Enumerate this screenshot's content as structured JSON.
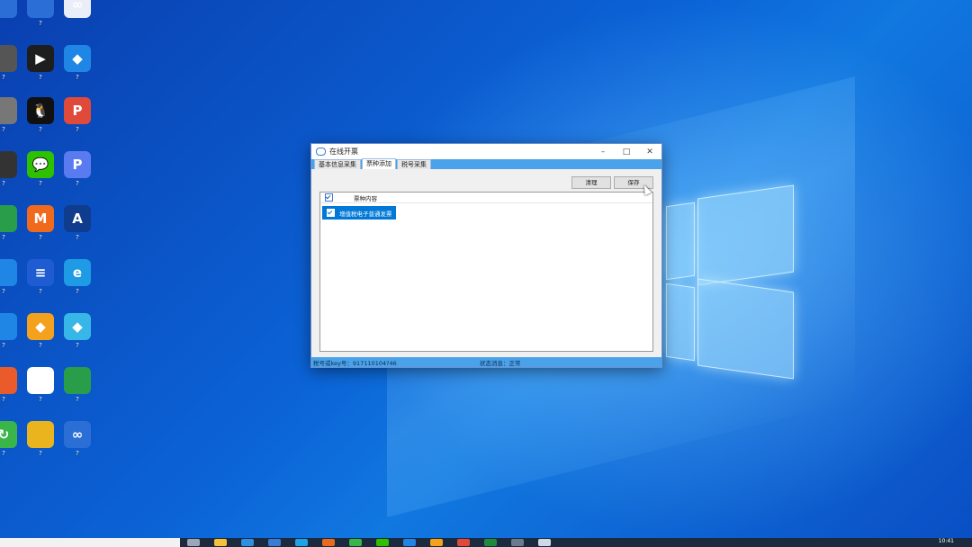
{
  "desktop": {
    "icons": [
      {
        "label": "",
        "glyph": "",
        "color": "#2b6fd6"
      },
      {
        "label": "?",
        "glyph": "",
        "color": "#2b6fd6"
      },
      {
        "label": "",
        "glyph": "∞",
        "color": "#e9eef9"
      },
      {
        "label": "?",
        "glyph": "",
        "color": "#555"
      },
      {
        "label": "?",
        "glyph": "▶",
        "color": "#1e1e1e"
      },
      {
        "label": "?",
        "glyph": "◆",
        "color": "#1f86e5"
      },
      {
        "label": "?",
        "glyph": "",
        "color": "#777"
      },
      {
        "label": "?",
        "glyph": "🐧",
        "color": "#111"
      },
      {
        "label": "?",
        "glyph": "P",
        "color": "#e04a3a"
      },
      {
        "label": "?",
        "glyph": "",
        "color": "#333"
      },
      {
        "label": "?",
        "glyph": "💬",
        "color": "#2dc100"
      },
      {
        "label": "?",
        "glyph": "P",
        "color": "#5a7bf0"
      },
      {
        "label": "?",
        "glyph": "",
        "color": "#2a9d4a"
      },
      {
        "label": "?",
        "glyph": "M",
        "color": "#f06a1e"
      },
      {
        "label": "?",
        "glyph": "A",
        "color": "#0f3c8c"
      },
      {
        "label": "?",
        "glyph": "",
        "color": "#1f86e5"
      },
      {
        "label": "?",
        "glyph": "≡",
        "color": "#1f5bd1"
      },
      {
        "label": "?",
        "glyph": "e",
        "color": "#1f9be5"
      },
      {
        "label": "?",
        "glyph": "",
        "color": "#1f86e5"
      },
      {
        "label": "?",
        "glyph": "◆",
        "color": "#f4a21e"
      },
      {
        "label": "?",
        "glyph": "◆",
        "color": "#37b6e8"
      },
      {
        "label": "?",
        "glyph": "",
        "color": "#e95b2a"
      },
      {
        "label": "?",
        "glyph": "e",
        "color": "#ffffff"
      },
      {
        "label": "?",
        "glyph": "",
        "color": "#2a9d4a"
      },
      {
        "label": "?",
        "glyph": "↻",
        "color": "#3ab54a"
      },
      {
        "label": "?",
        "glyph": "",
        "color": "#e9b41e"
      },
      {
        "label": "?",
        "glyph": "∞",
        "color": "#2b6fd6"
      }
    ]
  },
  "window": {
    "title": "在线开票",
    "minimize": "–",
    "maximize": "□",
    "close": "✕",
    "tabs": [
      {
        "label": "基本信息采集"
      },
      {
        "label": "票种添加"
      },
      {
        "label": "税号采集"
      }
    ],
    "buttons": {
      "clear": "清理",
      "save": "保存"
    },
    "list": {
      "header": "票种内容",
      "rows": [
        {
          "label": "增值税电子普通发票",
          "checked": true
        }
      ]
    },
    "status": {
      "tax_id": "税号或key号：917110104?46",
      "message": "状态消息：正常"
    }
  },
  "taskbar": {
    "search_placeholder": "",
    "clock": "10:41"
  }
}
